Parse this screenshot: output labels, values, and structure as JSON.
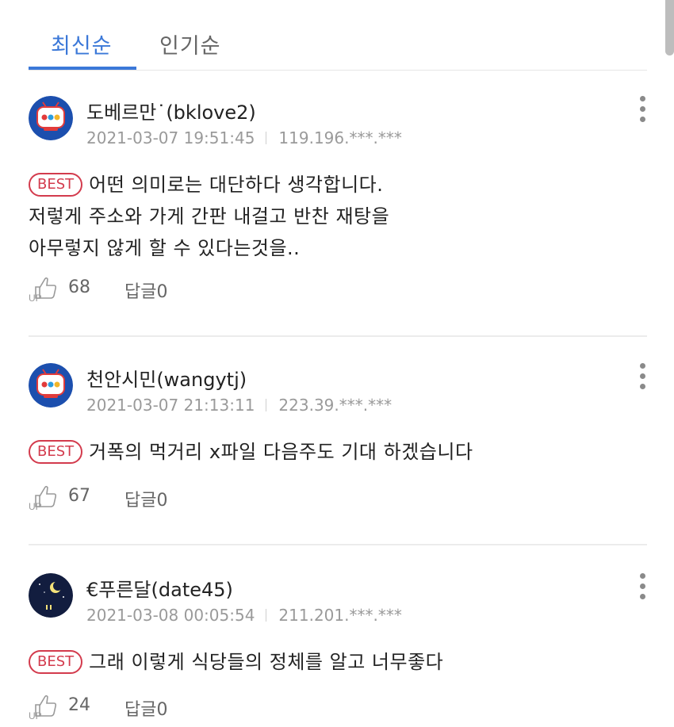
{
  "tabs": [
    {
      "label": "최신순",
      "active": true
    },
    {
      "label": "인기순",
      "active": false
    }
  ],
  "colors": {
    "accent": "#3b78d8",
    "best": "#d33b4d",
    "meta": "#9a9a9a"
  },
  "comments": [
    {
      "avatar_icon": "tv-mascot-avatar",
      "username": "도베르만˙(bklove2)",
      "date": "2021-03-07 19:51:45",
      "ip": "119.196.***.***",
      "best_label": "BEST",
      "lines": [
        "어떤 의미로는 대단하다 생각합니다.",
        "저렇게 주소와 가게 간판 내걸고 반찬 재탕을",
        "아무렇지 않게 할 수 있다는것을.."
      ],
      "up_count": "68",
      "reply_label": "답글0"
    },
    {
      "avatar_icon": "tv-mascot-avatar",
      "username": "천안시민(wangytj)",
      "date": "2021-03-07 21:13:11",
      "ip": "223.39.***.***",
      "best_label": "BEST",
      "lines": [
        "거폭의 먹거리 x파일 다음주도 기대 하겠습니다"
      ],
      "up_count": "67",
      "reply_label": "답글0"
    },
    {
      "avatar_icon": "night-moon-avatar",
      "username": "€푸른달(date45)",
      "date": "2021-03-08 00:05:54",
      "ip": "211.201.***.***",
      "best_label": "BEST",
      "lines": [
        "그래 이렇게 식당들의 정체를 알고 너무좋다"
      ],
      "up_count": "24",
      "reply_label": "답글0"
    }
  ]
}
